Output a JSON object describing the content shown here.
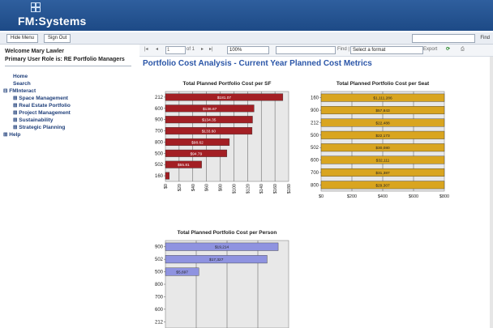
{
  "brand": {
    "name": "FM:Systems"
  },
  "toolbar": {
    "hide_menu": "Hide Menu",
    "sign_out": "Sign Out",
    "find": "Find"
  },
  "user": {
    "welcome": "Welcome Mary Lawler",
    "role": "Primary User Role is: RE Portfolio Managers"
  },
  "nav": {
    "home": "Home",
    "search": "Search",
    "fminteract": "FMInteract",
    "items": [
      "Space Management",
      "Real Estate Portfolio",
      "Project Management",
      "Sustainability",
      "Strategic Planning"
    ],
    "help": "Help"
  },
  "report": {
    "page_current": "1",
    "page_total": "of 1",
    "zoom": "100%",
    "find_next": "Find | Next",
    "format": "Select a format",
    "export": "Export"
  },
  "page_title": "Portfolio Cost Analysis - Current Year Planned Cost Metrics",
  "colors": {
    "sf": "#a31f24",
    "seat": "#d9a520",
    "person": "#8f93e0",
    "title": "#2b56a8"
  },
  "chart_data": [
    {
      "type": "bar",
      "title": "Total Planned Portfolio Cost per SF",
      "orientation": "horizontal",
      "categories": [
        "212",
        "600",
        "900",
        "700",
        "800",
        "500",
        "502",
        "160"
      ],
      "values": [
        181.07,
        136.67,
        134.35,
        133.6,
        98.62,
        94.79,
        55.81,
        6
      ],
      "labels": [
        "$181.07",
        "$136.67",
        "$134.35",
        "$133.60",
        "$98.62",
        "$94.79",
        "$55.81",
        ""
      ],
      "ticks": [
        "$0",
        "$20",
        "$40",
        "$60",
        "$80",
        "$100",
        "$120",
        "$140",
        "$160",
        "$180"
      ],
      "xlim": [
        0,
        190
      ]
    },
    {
      "type": "bar",
      "title": "Total Planned Portfolio Cost per Seat",
      "orientation": "horizontal",
      "categories": [
        "160",
        "900",
        "212",
        "500",
        "502",
        "600",
        "700",
        "800"
      ],
      "values": [
        1111286,
        57843,
        22488,
        22173,
        30080,
        32111,
        31387,
        29307
      ],
      "labels": [
        "$1,111,286",
        "$57,843",
        "$22,488",
        "$22,173",
        "$30,080",
        "$32,111",
        "$31,387",
        "$29,307"
      ],
      "ticks": [
        "$0",
        "$200",
        "$400",
        "$600",
        "$800"
      ],
      "xlim": [
        0,
        800
      ]
    },
    {
      "type": "bar",
      "title": "Total Planned Portfolio Cost per Person",
      "orientation": "horizontal",
      "categories": [
        "900",
        "502",
        "500",
        "800",
        "700",
        "600",
        "212"
      ],
      "values": [
        19214,
        17327,
        5697,
        0,
        0,
        0,
        0
      ],
      "labels": [
        "$19,214",
        "$17,327",
        "$5,697",
        "",
        "",
        "",
        ""
      ],
      "ticks": [],
      "xlim": [
        0,
        21000
      ]
    }
  ]
}
